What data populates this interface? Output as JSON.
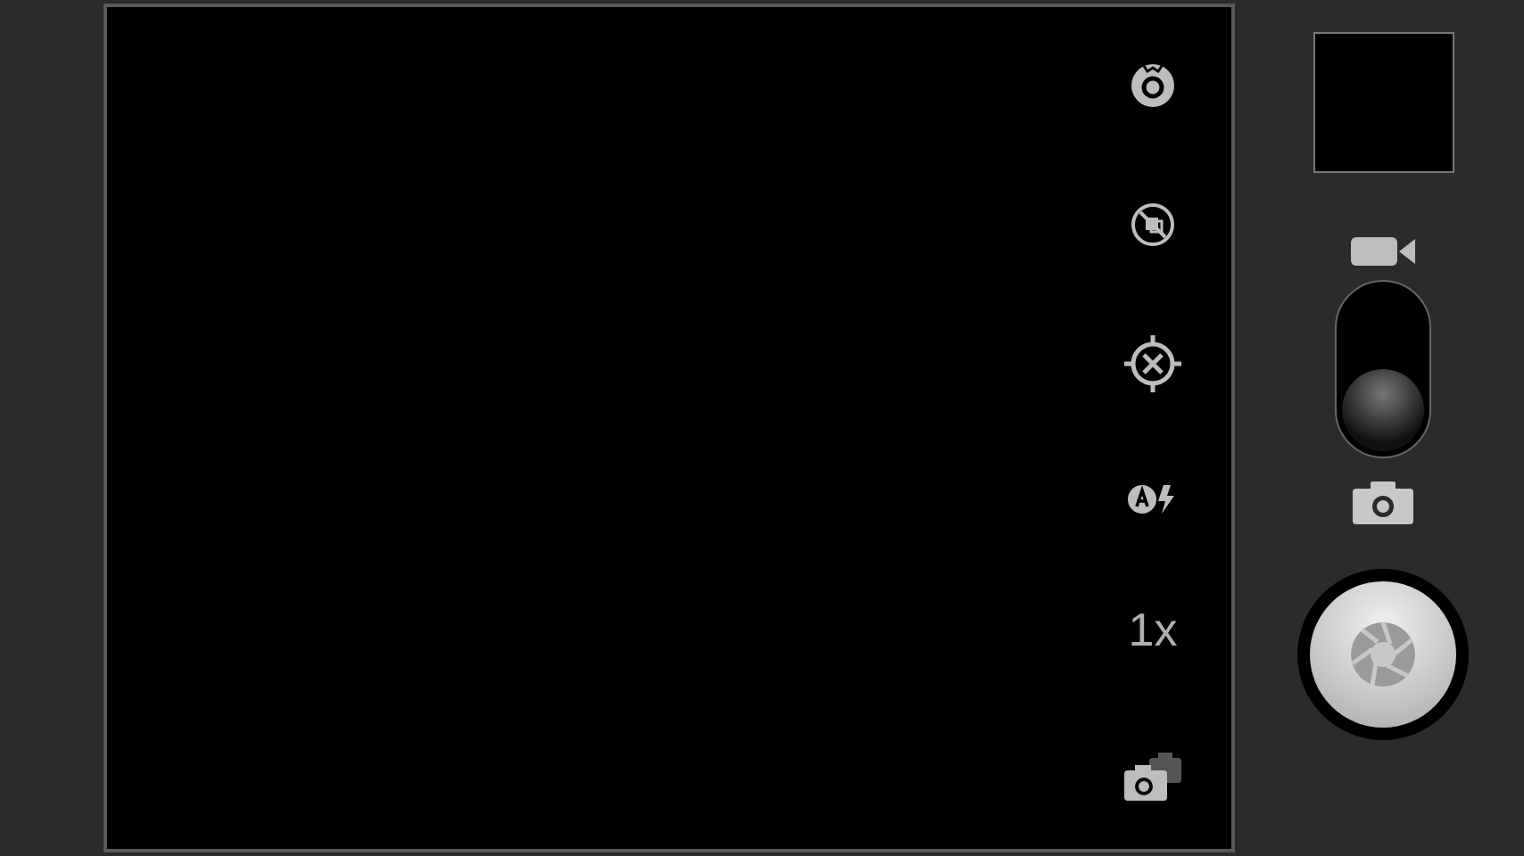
{
  "viewfinder": {
    "zoom_label": "1x"
  },
  "mode_switch": {
    "modes": [
      {
        "kind": "video",
        "selected": false
      },
      {
        "kind": "photo",
        "selected": true
      }
    ]
  }
}
